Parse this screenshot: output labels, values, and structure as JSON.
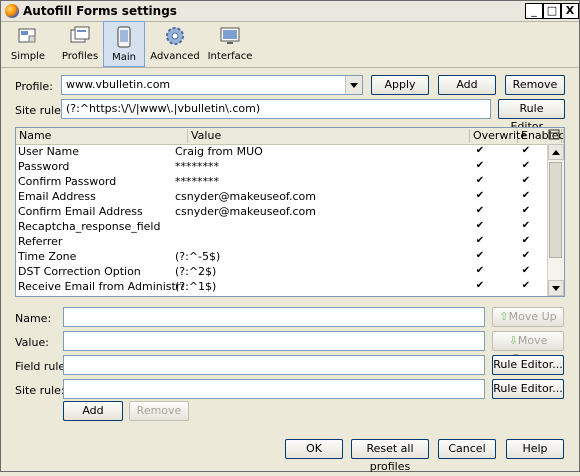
{
  "window": {
    "title": "Autofill Forms settings",
    "controls": [
      "_",
      "□",
      "X"
    ]
  },
  "tabs": [
    {
      "label": "Simple",
      "icon": "simple-icon"
    },
    {
      "label": "Profiles",
      "icon": "profiles-icon"
    },
    {
      "label": "Main",
      "icon": "main-icon",
      "active": true
    },
    {
      "label": "Advanced",
      "icon": "advanced-icon"
    },
    {
      "label": "Interface",
      "icon": "interface-icon"
    }
  ],
  "profile": {
    "label": "Profile:",
    "value": "www.vbulletin.com",
    "apply_label": "Apply",
    "add_label": "Add",
    "remove_label": "Remove"
  },
  "site_rule_top": {
    "label": "Site rule:",
    "value": "(?:^https:\\/\\/|www\\.|vbulletin\\.com)",
    "rule_editor_label": "Rule Editor..."
  },
  "table": {
    "headers": [
      "Name",
      "Value",
      "Overwrite",
      "Enabled"
    ],
    "rows": [
      {
        "name": "User Name",
        "value": "Craig from MUO",
        "overwrite": "✔",
        "enabled": "✔"
      },
      {
        "name": "Password",
        "value": "********",
        "overwrite": "✔",
        "enabled": "✔"
      },
      {
        "name": "Confirm Password",
        "value": "********",
        "overwrite": "✔",
        "enabled": "✔"
      },
      {
        "name": "Email Address",
        "value": "csnyder@makeuseof.com",
        "overwrite": "✔",
        "enabled": "✔"
      },
      {
        "name": "Confirm Email Address",
        "value": "csnyder@makeuseof.com",
        "overwrite": "✔",
        "enabled": "✔"
      },
      {
        "name": "Recaptcha_response_field",
        "value": "",
        "overwrite": "✔",
        "enabled": "✔"
      },
      {
        "name": "Referrer",
        "value": "",
        "overwrite": "✔",
        "enabled": "✔"
      },
      {
        "name": "Time Zone",
        "value": "(?:^-5$)",
        "overwrite": "✔",
        "enabled": "✔"
      },
      {
        "name": "DST Correction Option",
        "value": "(?:^2$)",
        "overwrite": "✔",
        "enabled": "✔"
      },
      {
        "name": "Receive Email from Administrators",
        "value": "(?:^1$)",
        "overwrite": "✔",
        "enabled": "✔"
      }
    ]
  },
  "edit": {
    "name_label": "Name:",
    "value_label": "Value:",
    "field_rule_label": "Field rule:",
    "site_rule_label": "Site rule:",
    "move_up_label": "Move Up",
    "move_down_label": "Move Down",
    "field_rule_editor_label": "Rule Editor...",
    "site_rule_editor_label": "Rule Editor...",
    "add_label": "Add",
    "remove_label": "Remove"
  },
  "footer": {
    "ok_label": "OK",
    "reset_label": "Reset all profiles",
    "cancel_label": "Cancel",
    "help_label": "Help"
  }
}
